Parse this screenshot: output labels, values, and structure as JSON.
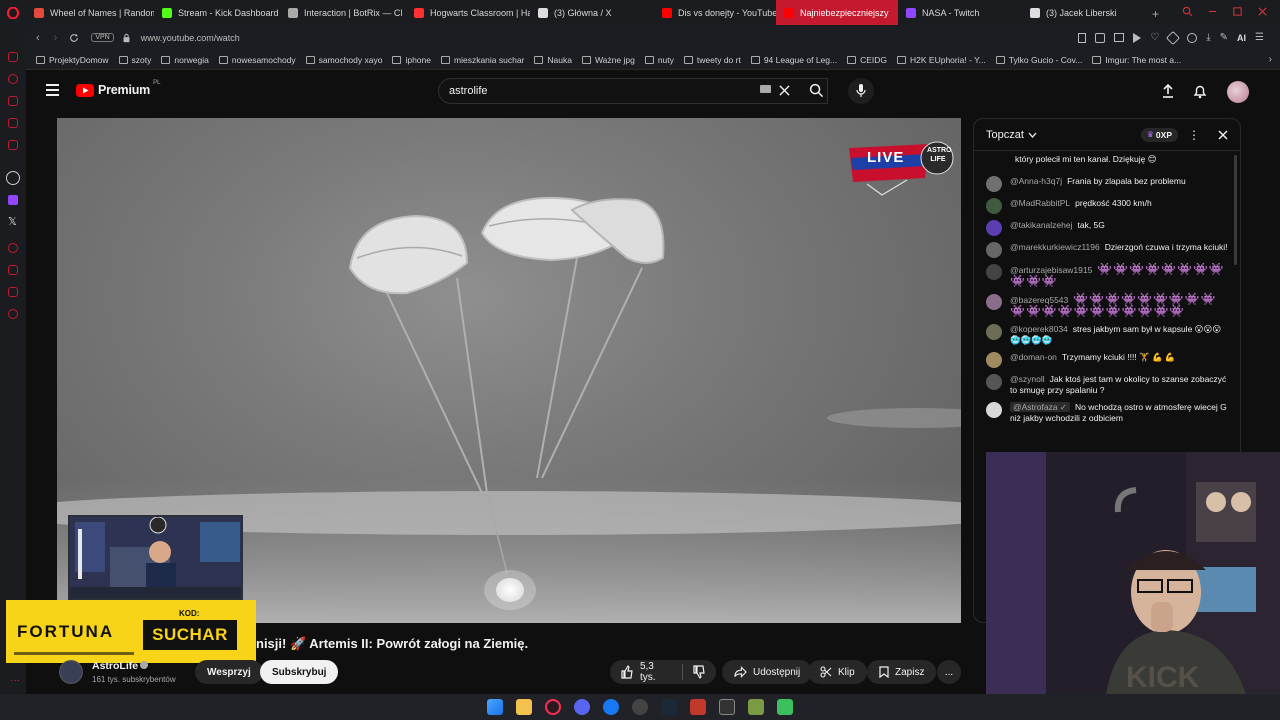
{
  "browser": {
    "tabs": [
      {
        "label": "Wheel of Names | Random",
        "color": "#e24a3b"
      },
      {
        "label": "Stream - Kick Dashboard",
        "color": "#53fc18"
      },
      {
        "label": "Interaction | BotRix — Cl",
        "color": "#aaaaaa"
      },
      {
        "label": "Hogwarts Classroom | Ha",
        "color": "#ff3030"
      },
      {
        "label": "(3) Główna / X",
        "color": "#dddddd"
      },
      {
        "label": "Dis vs donejty - YouTube",
        "color": "#ff0000"
      },
      {
        "label": "Najniebezpieczniejszy",
        "color": "#ff0000",
        "active": true
      },
      {
        "label": "NASA - Twitch",
        "color": "#9146ff"
      },
      {
        "label": "(3) Jacek Liberski",
        "color": "#dddddd"
      }
    ],
    "vpn_label": "VPN",
    "url": "www.youtube.com/watch",
    "ai_label": "AI",
    "bookmarks": [
      "ProjektyDomow",
      "szoty",
      "norwegia",
      "nowesamochody",
      "samochody xayo",
      "iphone",
      "mieszkania suchar",
      "Nauka",
      "Ważne jpg",
      "nuty",
      "tweety do rt",
      "94 League of Leg...",
      "CEIDG",
      "H2K EUphoria! - Y...",
      "Tylko Gucio - Cov...",
      "Imgur: The most a..."
    ]
  },
  "youtube": {
    "logo_text": "Premium",
    "logo_sup": "PL",
    "search_value": "astrolife",
    "video": {
      "badge_live": "LIVE",
      "badge_brand": "ASTRO LIFE",
      "title": "nisji! 🚀 Artemis II: Powrót załogi na Ziemię.",
      "channel": "AstroLife",
      "subscribers": "161 tys. subskrybentów",
      "support_label": "Wesprzyj",
      "subscribe_label": "Subskrybuj",
      "likes": "5,3 tys.",
      "share_label": "Udostępnij",
      "clip_label": "Klip",
      "save_label": "Zapisz",
      "more_label": "..."
    },
    "promo": {
      "brand": "FORTUNA",
      "code_label": "KOD:",
      "code": "SUCHAR"
    },
    "chat": {
      "mode_label": "Topczat",
      "xp_label": "0XP",
      "messages": [
        {
          "author": "",
          "text": "który polecił mi ten kanał. Dziękuję 😊",
          "avatar": "#555555"
        },
        {
          "author": "@Anna-h3q7j",
          "text": "Frania by zlapala bez problemu",
          "avatar": "#707070"
        },
        {
          "author": "@MadRabbitPL",
          "text": "prędkość 4300 km/h",
          "avatar": "#3f5a3f"
        },
        {
          "author": "@takikanalzehej",
          "text": "tak, 5G",
          "avatar": "#5b3fb0"
        },
        {
          "author": "@marekkurkiewicz1196",
          "text": "Dzierzgoń czuwa i trzyma kciuki!",
          "avatar": "#666666"
        },
        {
          "author": "@arturzajebisaw1915",
          "text": "👾👾👾👾👾👾👾👾👾👾👾",
          "avatar": "#444444"
        },
        {
          "author": "@bazereq5543",
          "text": "👾👾👾👾👾👾👾👾👾👾👾👾👾👾👾👾👾👾👾👾",
          "avatar": "#8a6d8a"
        },
        {
          "author": "@koperek8034",
          "text": "stres jakbym sam był w kapsule 😮😮😮🥶🥶🥶🥶",
          "avatar": "#6d6d55"
        },
        {
          "author": "@doman-on",
          "text": "Trzymamy kciuki !!!! 🏋 💪 💪",
          "avatar": "#a08a60"
        },
        {
          "author": "@szynoll",
          "text": "Jak ktoś jest tam w okolicy to szanse zobaczyć to smugę przy spalaniu ?",
          "avatar": "#555555"
        },
        {
          "author": "@Astrofaza ✓",
          "text": "No wchodzą ostro w atmosferę wiecej G niż jakby wchodzili z odbiciem",
          "avatar": "#d8d8d8"
        }
      ]
    }
  }
}
